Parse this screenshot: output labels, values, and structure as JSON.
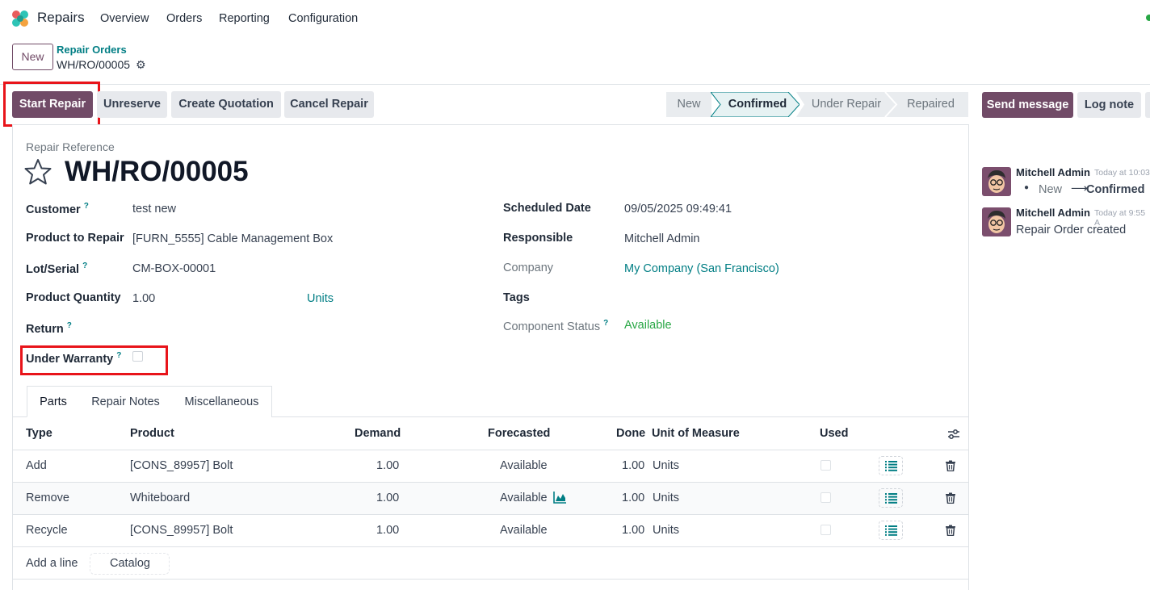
{
  "nav": {
    "app_name": "Repairs",
    "items": [
      "Overview",
      "Orders",
      "Reporting",
      "Configuration"
    ]
  },
  "control": {
    "new_label": "New",
    "breadcrumb_parent": "Repair Orders",
    "breadcrumb_current": "WH/RO/00005"
  },
  "actions": {
    "start_repair": "Start Repair",
    "unreserve": "Unreserve",
    "create_quotation": "Create Quotation",
    "cancel_repair": "Cancel Repair"
  },
  "statusbar": {
    "stages": [
      "New",
      "Confirmed",
      "Under Repair",
      "Repaired"
    ],
    "active": "Confirmed"
  },
  "chatter": {
    "send_message": "Send message",
    "log_note": "Log note",
    "messages": [
      {
        "author": "Mitchell Admin",
        "time": "Today at 10:03",
        "change_from": "New",
        "change_to": "Confirmed"
      },
      {
        "author": "Mitchell Admin",
        "time": "Today at 9:55 A",
        "body": "Repair Order created"
      }
    ]
  },
  "form": {
    "ref_label": "Repair Reference",
    "title": "WH/RO/00005",
    "left": {
      "customer_label": "Customer",
      "customer_value": "test new",
      "product_label": "Product to Repair",
      "product_value": "[FURN_5555] Cable Management Box",
      "lot_label": "Lot/Serial",
      "lot_value": "CM-BOX-00001",
      "qty_label": "Product Quantity",
      "qty_value": "1.00",
      "qty_uom": "Units",
      "return_label": "Return",
      "warranty_label": "Under Warranty"
    },
    "right": {
      "sched_label": "Scheduled Date",
      "sched_value": "09/05/2025 09:49:41",
      "resp_label": "Responsible",
      "resp_value": "Mitchell Admin",
      "company_label": "Company",
      "company_value": "My Company (San Francisco)",
      "tags_label": "Tags",
      "comp_status_label": "Component Status",
      "comp_status_value": "Available"
    },
    "help_mark": "?"
  },
  "tabs": [
    "Parts",
    "Repair Notes",
    "Miscellaneous"
  ],
  "table": {
    "headers": [
      "Type",
      "Product",
      "Demand",
      "Forecasted",
      "Done",
      "Unit of Measure",
      "Used"
    ],
    "rows": [
      {
        "type": "Add",
        "product": "[CONS_89957] Bolt",
        "demand": "1.00",
        "forecasted": "Available",
        "done": "1.00",
        "uom": "Units"
      },
      {
        "type": "Remove",
        "product": "Whiteboard",
        "demand": "1.00",
        "forecasted": "Available",
        "done": "1.00",
        "uom": "Units"
      },
      {
        "type": "Recycle",
        "product": "[CONS_89957] Bolt",
        "demand": "1.00",
        "forecasted": "Available",
        "done": "1.00",
        "uom": "Units"
      }
    ],
    "add_line": "Add a line",
    "catalog": "Catalog"
  },
  "colors": {
    "primary": "#714b67",
    "link": "#017e84",
    "success": "#28a745",
    "highlight": "#e8141a"
  }
}
